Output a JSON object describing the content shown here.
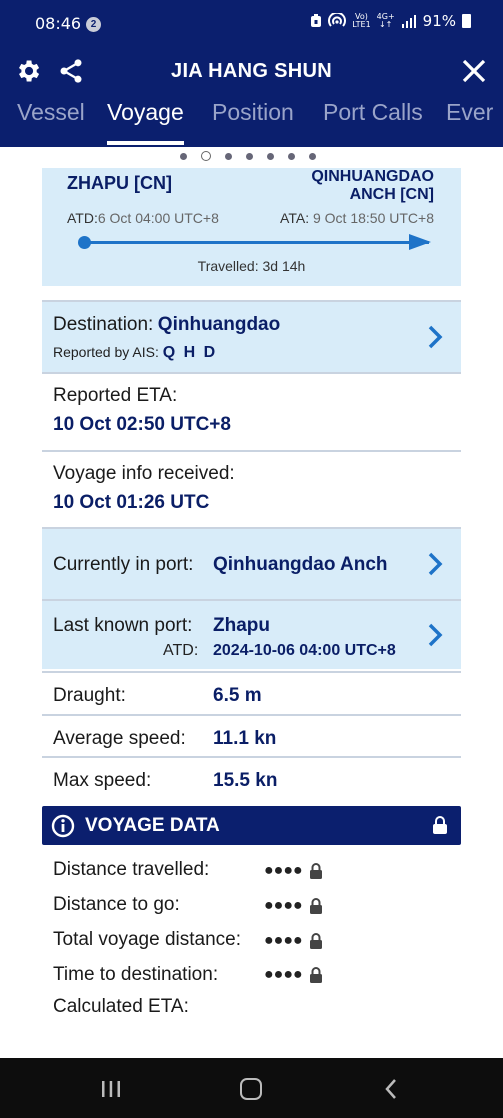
{
  "status_bar": {
    "time": "08:46",
    "notif_count": "2",
    "volte": "Vo)",
    "lte": "LTE1",
    "net": "4G+",
    "battery": "91%"
  },
  "header": {
    "title": "JIA HANG SHUN",
    "tabs": [
      "Vessel",
      "Voyage",
      "Position",
      "Port Calls",
      "Ever"
    ],
    "active_tab": "Voyage"
  },
  "route": {
    "from": "ZHAPU [CN]",
    "to_line1": "QINHUANGDAO",
    "to_line2": "ANCH [CN]",
    "atd_label": "ATD:",
    "atd_value": "6 Oct 04:00 UTC+8",
    "ata_label": "ATA:",
    "ata_value": "9 Oct 18:50 UTC+8",
    "travelled": "Travelled: 3d 14h"
  },
  "destination": {
    "label": "Destination:",
    "value": "Qinhuangdao",
    "ais_label": "Reported by AIS:",
    "ais_value": "Q H D"
  },
  "reported_eta": {
    "label": "Reported ETA:",
    "value": "10 Oct 02:50 UTC+8"
  },
  "voyage_info": {
    "label": "Voyage info received:",
    "value": "10 Oct 01:26 UTC"
  },
  "current_port": {
    "label": "Currently in port:",
    "value": "Qinhuangdao Anch"
  },
  "last_port": {
    "label": "Last known port:",
    "value": "Zhapu",
    "atd_label": "ATD:",
    "atd_value": "2024-10-06 04:00 UTC+8"
  },
  "stats": {
    "draught_label": "Draught:",
    "draught_value": "6.5 m",
    "avg_label": "Average speed:",
    "avg_value": "11.1 kn",
    "max_label": "Max speed:",
    "max_value": "15.5 kn"
  },
  "voyage_data": {
    "header": "VOYAGE DATA",
    "masked": "●●●●",
    "items": [
      "Distance travelled:",
      "Distance to go:",
      "Total voyage distance:",
      "Time to destination:",
      "Calculated ETA:"
    ]
  }
}
